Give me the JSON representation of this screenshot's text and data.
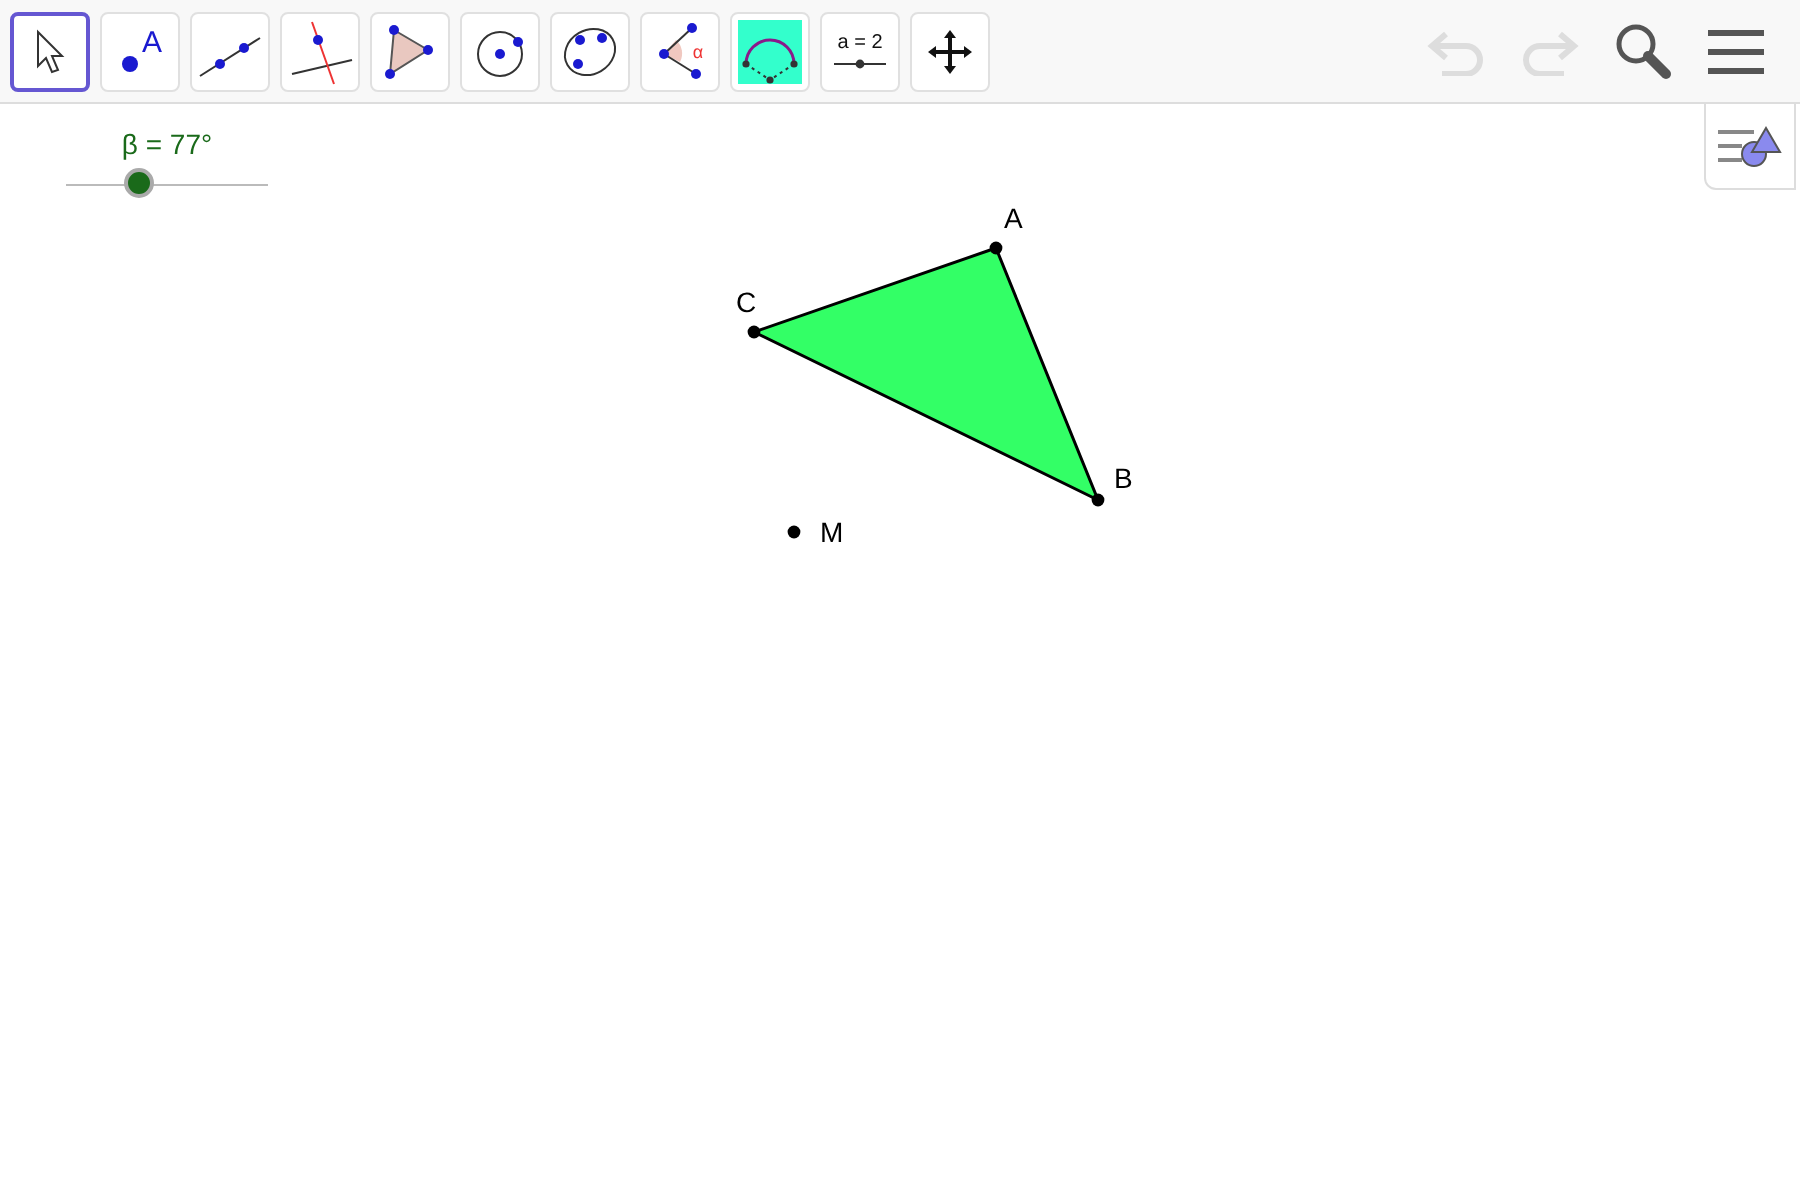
{
  "toolbar": {
    "tools": [
      {
        "kind": "move",
        "selected": true
      },
      {
        "kind": "point",
        "label": "A",
        "selected": false
      },
      {
        "kind": "line",
        "selected": false
      },
      {
        "kind": "perpendicular",
        "selected": false
      },
      {
        "kind": "polygon",
        "selected": false
      },
      {
        "kind": "circle",
        "selected": false
      },
      {
        "kind": "conic",
        "selected": false
      },
      {
        "kind": "angle",
        "label": "α",
        "selected": false
      },
      {
        "kind": "reflect",
        "selected": false
      },
      {
        "kind": "slider",
        "label": "a = 2",
        "selected": false
      },
      {
        "kind": "move-view",
        "selected": false
      }
    ],
    "undo": {
      "disabled": true
    },
    "redo": {
      "disabled": true
    }
  },
  "slider": {
    "label": "β = 77°",
    "level": 0.37
  },
  "canvas": {
    "points": [
      {
        "label": "A"
      },
      {
        "label": "B"
      },
      {
        "label": "C"
      },
      {
        "label": "M"
      }
    ],
    "polygon": {
      "color": "#33ff66"
    }
  }
}
